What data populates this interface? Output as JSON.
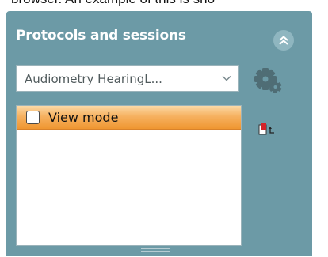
{
  "background_text": "browser. An example of this is sho",
  "panel": {
    "title": "Protocols and sessions",
    "collapse_icon": "double-chevron-up-icon",
    "protocol_select": {
      "selected": "Audiometry HearingL..."
    },
    "settings_icon": "gear-icon",
    "sessions_list": [
      {
        "label": "View mode",
        "checked": false,
        "highlighted": true
      }
    ],
    "restore_icon": "restore-session-icon",
    "resize_handle_icon": "grip-lines-icon"
  },
  "colors": {
    "panel_bg": "#6c9aa6",
    "highlight_top": "#fcd9a6",
    "highlight_bottom": "#ef9630"
  }
}
